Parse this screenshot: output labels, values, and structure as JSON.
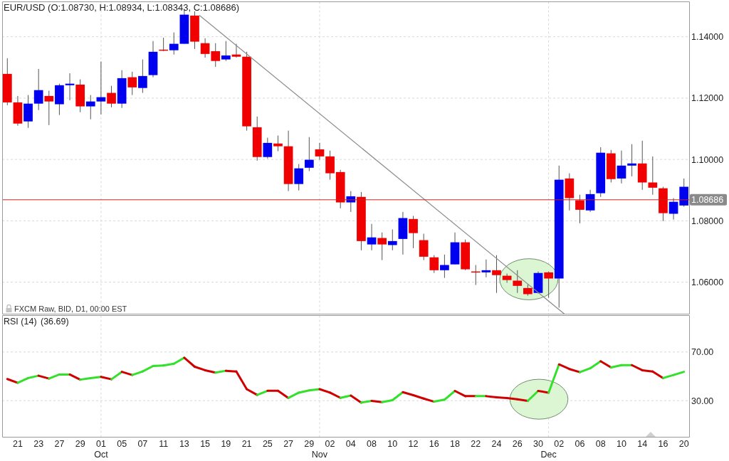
{
  "price_panel": {
    "source_info": "FXCM Raw, BID, D1, 00:00 EST",
    "chart_data": {
      "type": "candlestick",
      "title": "EUR/USD (O:1.08730, H:1.08934, L:1.08343, C:1.08686)",
      "ylim": [
        1.0496,
        1.1514
      ],
      "grid": true,
      "yticks": [
        {
          "value": 1.06,
          "label": "1.06000"
        },
        {
          "value": 1.08,
          "label": "1.08000"
        },
        {
          "value": 1.1,
          "label": "1.10000"
        },
        {
          "value": 1.12,
          "label": "1.12000"
        },
        {
          "value": 1.14,
          "label": "1.14000"
        }
      ],
      "ohlc": [
        [
          1.1279,
          1.133,
          1.1177,
          1.1186
        ],
        [
          1.1186,
          1.1207,
          1.111,
          1.1117
        ],
        [
          1.1124,
          1.121,
          1.1103,
          1.1182
        ],
        [
          1.1182,
          1.1295,
          1.1161,
          1.1226
        ],
        [
          1.1207,
          1.1224,
          1.1112,
          1.1189
        ],
        [
          1.118,
          1.1247,
          1.1145,
          1.1242
        ],
        [
          1.1242,
          1.1281,
          1.1193,
          1.1247
        ],
        [
          1.1244,
          1.1261,
          1.1154,
          1.1173
        ],
        [
          1.1173,
          1.121,
          1.1131,
          1.1189
        ],
        [
          1.1189,
          1.1319,
          1.1147,
          1.1203
        ],
        [
          1.1217,
          1.124,
          1.117,
          1.1182
        ],
        [
          1.1182,
          1.1291,
          1.1168,
          1.1265
        ],
        [
          1.1268,
          1.1286,
          1.121,
          1.1235
        ],
        [
          1.1233,
          1.1326,
          1.1217,
          1.1272
        ],
        [
          1.1275,
          1.1386,
          1.1268,
          1.1351
        ],
        [
          1.1358,
          1.1397,
          1.1353,
          1.1356
        ],
        [
          1.1356,
          1.1414,
          1.1342,
          1.1377
        ],
        [
          1.1377,
          1.1488,
          1.1377,
          1.1472
        ],
        [
          1.1469,
          1.1483,
          1.136,
          1.1384
        ],
        [
          1.1379,
          1.1395,
          1.1332,
          1.1344
        ],
        [
          1.1353,
          1.1379,
          1.1302,
          1.1321
        ],
        [
          1.1326,
          1.1386,
          1.1321,
          1.1339
        ],
        [
          1.1342,
          1.1377,
          1.1332,
          1.1335
        ],
        [
          1.1335,
          1.1351,
          1.1094,
          1.1108
        ],
        [
          1.1105,
          1.114,
          1.0996,
          1.1008
        ],
        [
          1.1008,
          1.1071,
          1.1003,
          1.1054
        ],
        [
          1.1052,
          1.1078,
          1.1027,
          1.1043
        ],
        [
          1.1043,
          1.1094,
          1.0897,
          1.092
        ],
        [
          1.092,
          1.0985,
          1.0899,
          1.0971
        ],
        [
          1.0973,
          1.1073,
          1.0962,
          1.0999
        ],
        [
          1.1033,
          1.1054,
          1.0999,
          1.101
        ],
        [
          1.101,
          1.1029,
          1.0934,
          1.0955
        ],
        [
          1.0959,
          1.0966,
          1.0841,
          1.086
        ],
        [
          1.086,
          1.0897,
          1.0829,
          1.088
        ],
        [
          1.0878,
          1.0894,
          1.0704,
          1.0734
        ],
        [
          1.0723,
          1.079,
          1.0704,
          1.0746
        ],
        [
          1.0744,
          1.0762,
          1.0672,
          1.0723
        ],
        [
          1.0721,
          1.0772,
          1.0704,
          1.0734
        ],
        [
          1.0741,
          1.0829,
          1.069,
          1.0809
        ],
        [
          1.0806,
          1.0816,
          1.0711,
          1.076
        ],
        [
          1.0737,
          1.0758,
          1.0672,
          1.0683
        ],
        [
          1.0681,
          1.0688,
          1.063,
          1.0639
        ],
        [
          1.0639,
          1.069,
          1.0614,
          1.0656
        ],
        [
          1.0658,
          1.0762,
          1.0658,
          1.073
        ],
        [
          1.073,
          1.0739,
          1.0639,
          1.0642
        ],
        [
          1.0635,
          1.0656,
          1.0591,
          1.0632
        ],
        [
          1.0632,
          1.0674,
          1.0616,
          1.0639
        ],
        [
          1.0639,
          1.0688,
          1.0565,
          1.0623
        ],
        [
          1.0621,
          1.0628,
          1.0598,
          1.0607
        ],
        [
          1.0605,
          1.0639,
          1.0565,
          1.0588
        ],
        [
          1.0581,
          1.0593,
          1.0556,
          1.0561
        ],
        [
          1.0565,
          1.0635,
          1.0563,
          1.063
        ],
        [
          1.0632,
          1.0635,
          1.0549,
          1.0612
        ],
        [
          1.0612,
          1.098,
          1.0517,
          1.0934
        ],
        [
          1.0938,
          1.0955,
          1.0834,
          1.0874
        ],
        [
          1.0867,
          1.0885,
          1.0792,
          1.0836
        ],
        [
          1.0834,
          1.0901,
          1.0829,
          1.0887
        ],
        [
          1.089,
          1.104,
          1.0878,
          1.1022
        ],
        [
          1.102,
          1.1031,
          1.0925,
          1.0936
        ],
        [
          1.0938,
          1.1029,
          1.0922,
          1.098
        ],
        [
          1.098,
          1.105,
          1.0945,
          1.0987
        ],
        [
          1.0987,
          1.1061,
          1.0901,
          1.0925
        ],
        [
          1.0925,
          1.101,
          1.0885,
          1.0908
        ],
        [
          1.0906,
          1.0911,
          1.0799,
          1.0825
        ],
        [
          1.0823,
          1.0874,
          1.0804,
          1.0862
        ],
        [
          1.085,
          1.0938,
          1.0846,
          1.0911
        ]
      ],
      "ref_lines": [
        {
          "axis": "y",
          "value": 1.08686,
          "label": "1.08686",
          "color": "#c82020"
        }
      ]
    }
  },
  "rsi_panel": {
    "reading": "(36.69)",
    "months": [
      "Oct",
      "Nov",
      "Dec"
    ],
    "chart_data": {
      "type": "line",
      "title": "RSI (14)",
      "ylim": [
        0,
        100
      ],
      "grid": true,
      "yticks": [
        {
          "value": 30,
          "label": "30.00"
        },
        {
          "value": 70,
          "label": "70.00"
        }
      ],
      "categories": [
        null,
        "21",
        null,
        "23",
        null,
        "27",
        null,
        "29",
        null,
        "01",
        null,
        "05",
        null,
        "07",
        null,
        "11",
        null,
        "13",
        null,
        "15",
        null,
        "19",
        null,
        "21",
        null,
        "25",
        null,
        "27",
        null,
        "29",
        null,
        "02",
        null,
        "04",
        null,
        "08",
        null,
        "10",
        null,
        "12",
        null,
        "16",
        null,
        "18",
        null,
        "22",
        null,
        "24",
        null,
        "26",
        null,
        "30",
        null,
        "02",
        null,
        "06",
        null,
        "08",
        null,
        "10",
        null,
        "14",
        null,
        "16",
        null,
        "20"
      ],
      "series": [
        {
          "color": "#33e02a",
          "values": [
            null,
            44.7,
            48.6,
            50.5,
            48.2,
            51.5,
            51.5,
            47.3,
            48.6,
            49.6,
            47.6,
            53.7,
            51.1,
            54.0,
            58.5,
            58.9,
            60.4,
            65.3,
            null,
            null,
            53.1,
            54.6,
            null,
            null,
            34.7,
            38.1,
            null,
            32.2,
            36.6,
            38.5,
            39.5,
            null,
            32.3,
            34.2,
            28.4,
            29.8,
            28.8,
            30.4,
            37.0,
            null,
            null,
            29.2,
            30.8,
            38.0,
            null,
            33.7,
            33.7,
            null,
            null,
            null,
            29.8,
            38.0,
            36.6,
            59.8,
            null,
            53.4,
            56.6,
            62.4,
            57.3,
            59.2,
            59.2,
            null,
            null,
            48.6,
            51.1,
            53.7
          ]
        },
        {
          "color": "#d00000",
          "values": [
            47.8,
            44.7,
            null,
            50.5,
            48.2,
            null,
            51.5,
            47.3,
            null,
            49.6,
            47.6,
            53.7,
            51.1,
            null,
            null,
            null,
            null,
            65.3,
            57.9,
            55.0,
            53.1,
            54.6,
            54.0,
            39.5,
            34.7,
            38.1,
            38.1,
            32.2,
            null,
            null,
            39.5,
            36.6,
            32.3,
            34.2,
            28.4,
            29.8,
            28.8,
            null,
            37.0,
            34.5,
            31.7,
            29.2,
            null,
            38.0,
            33.7,
            33.7,
            33.7,
            32.7,
            32.2,
            31.2,
            29.8,
            38.0,
            36.6,
            59.8,
            56.0,
            53.4,
            null,
            62.4,
            57.3,
            null,
            59.2,
            55.0,
            54.0,
            48.6,
            null,
            null
          ]
        }
      ]
    }
  }
}
